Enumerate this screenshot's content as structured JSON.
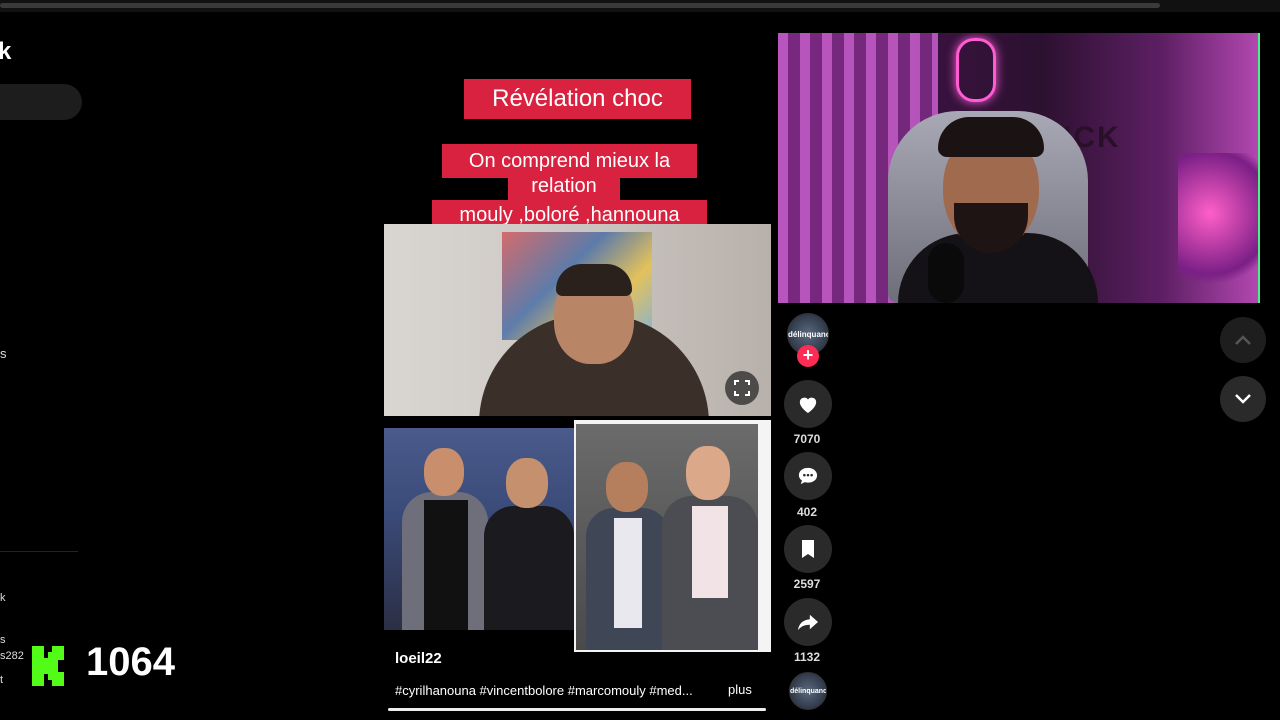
{
  "sidebar": {
    "logo_fragment": "k",
    "item_fragment_1": "s",
    "item_fragment_2": "k",
    "item_fragment_3": "s",
    "item_fragment_4": "s282",
    "item_fragment_5": "t"
  },
  "video": {
    "caption_title": "Révélation choc",
    "caption_line1": "On comprend mieux la",
    "caption_line2": "relation",
    "caption_line3": "mouly ,boloré ,hannouna",
    "author": "loeil22",
    "hashtags": "#cyrilhanouna #vincentbolore #marcomouly #med...",
    "more_label": "plus",
    "progress": 1.0
  },
  "actions": {
    "avatar_text": "délinquance",
    "follow_label": "+",
    "like_count": "7070",
    "comment_count": "402",
    "save_count": "2597",
    "share_count": "1132"
  },
  "icons": {
    "fullscreen": "fullscreen-icon",
    "like": "heart-icon",
    "comment": "comment-icon",
    "save": "bookmark-icon",
    "share": "share-icon",
    "nav_up": "chevron-up-icon",
    "nav_down": "chevron-down-icon"
  },
  "webcam": {
    "sign_text": "ICK"
  },
  "overlay": {
    "viewer_count": "1064"
  },
  "colors": {
    "caption_red": "#d8223f",
    "follow_pink": "#fe2c55",
    "kick_green": "#53fc18"
  }
}
